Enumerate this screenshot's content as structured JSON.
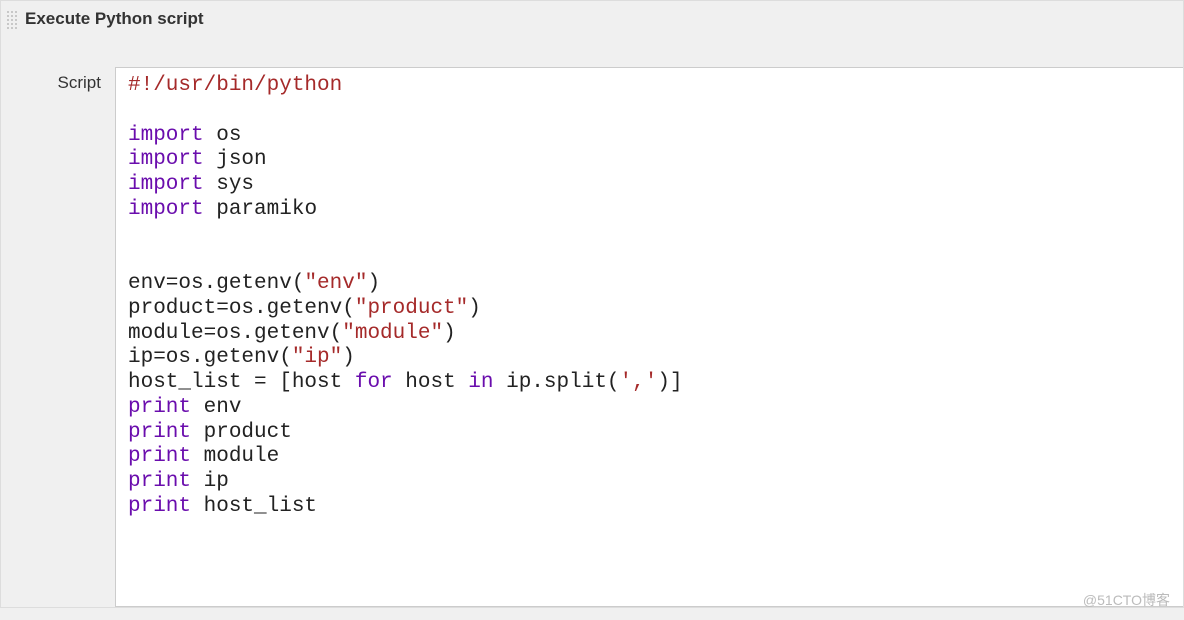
{
  "header": {
    "title": "Execute Python script"
  },
  "form": {
    "script_label": "Script"
  },
  "code": {
    "shebang": "#!/usr/bin/python",
    "imports": {
      "kw": "import",
      "mod1": " os",
      "mod2": " json",
      "mod3": " sys",
      "mod4": " paramiko"
    },
    "l1a": "env=os.getenv(",
    "l1b": "\"env\"",
    "l1c": ")",
    "l2a": "product=os.getenv(",
    "l2b": "\"product\"",
    "l2c": ")",
    "l3a": "module=os.getenv(",
    "l3b": "\"module\"",
    "l3c": ")",
    "l4a": "ip=os.getenv(",
    "l4b": "\"ip\"",
    "l4c": ")",
    "l5a": "host_list = [host ",
    "l5_for": "for",
    "l5b": " host ",
    "l5_in": "in",
    "l5c": " ip.split(",
    "l5d": "','",
    "l5e": ")]",
    "print_kw": "print",
    "p1": " env",
    "p2": " product",
    "p3": " module",
    "p4": " ip",
    "p5": " host_list"
  },
  "watermark": "@51CTO博客"
}
